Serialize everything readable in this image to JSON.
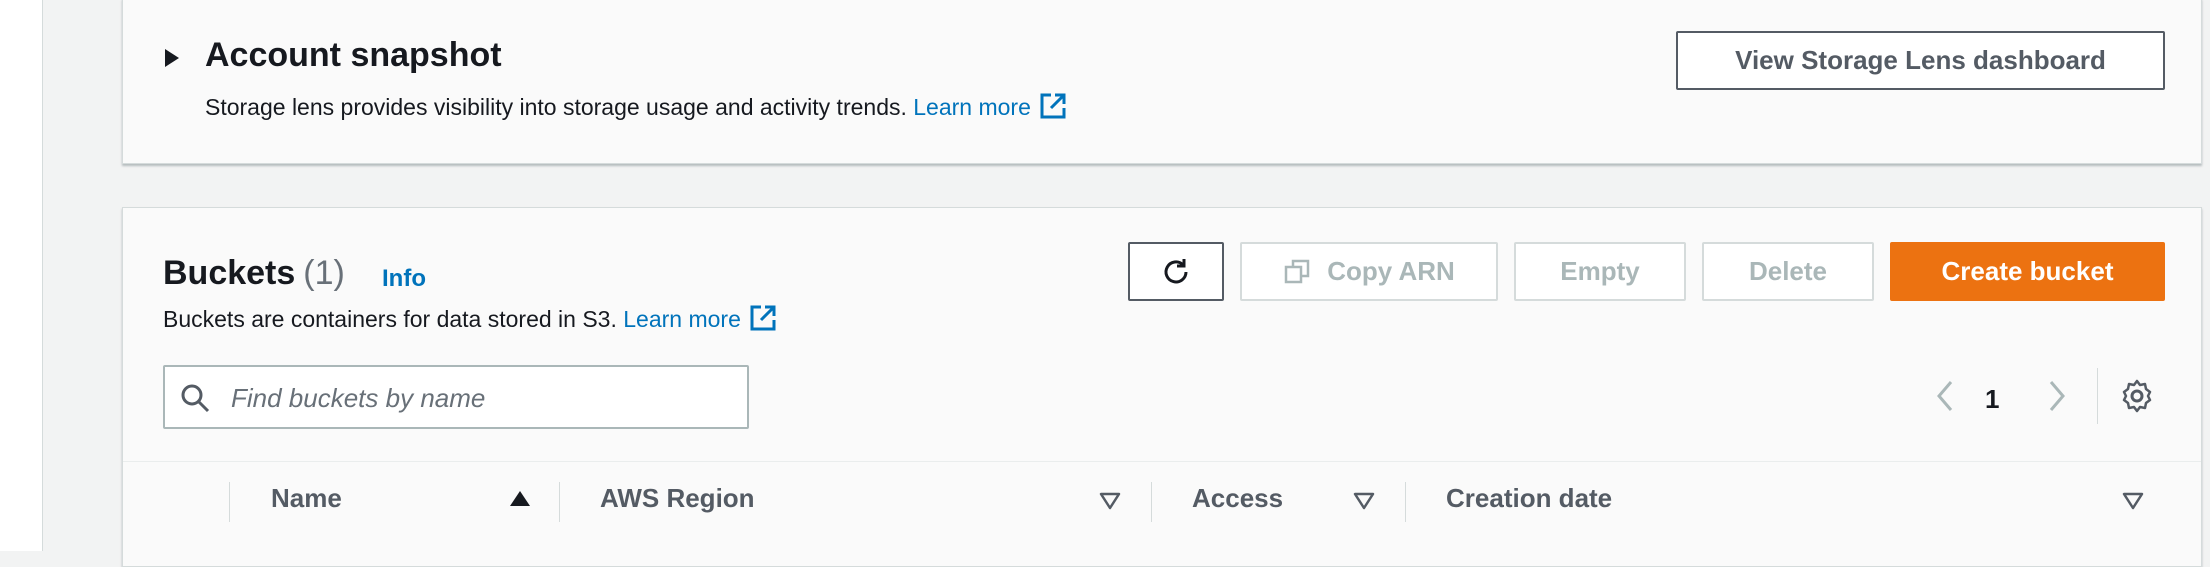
{
  "snapshot": {
    "title": "Account snapshot",
    "description": "Storage lens provides visibility into storage usage and activity trends.",
    "learn_more": "Learn more",
    "view_dashboard_label": "View Storage Lens dashboard"
  },
  "buckets": {
    "title": "Buckets",
    "count": "(1)",
    "info": "Info",
    "description": "Buckets are containers for data stored in S3.",
    "learn_more": "Learn more",
    "actions": {
      "copy_arn": "Copy ARN",
      "empty": "Empty",
      "delete": "Delete",
      "create": "Create bucket"
    },
    "search": {
      "placeholder": "Find buckets by name",
      "value": ""
    },
    "pagination": {
      "current_page": "1"
    },
    "columns": [
      "Name",
      "AWS Region",
      "Access",
      "Creation date"
    ]
  },
  "colors": {
    "primary_button": "#ec7211",
    "link": "#0073bb",
    "disabled_text": "#aab7b8"
  },
  "icons": [
    "expand-caret-icon",
    "external-link-icon",
    "refresh-icon",
    "copy-icon",
    "search-icon",
    "chevron-left-icon",
    "chevron-right-icon",
    "settings-gear-icon",
    "sort-ascending-icon",
    "sort-descending-icon"
  ]
}
